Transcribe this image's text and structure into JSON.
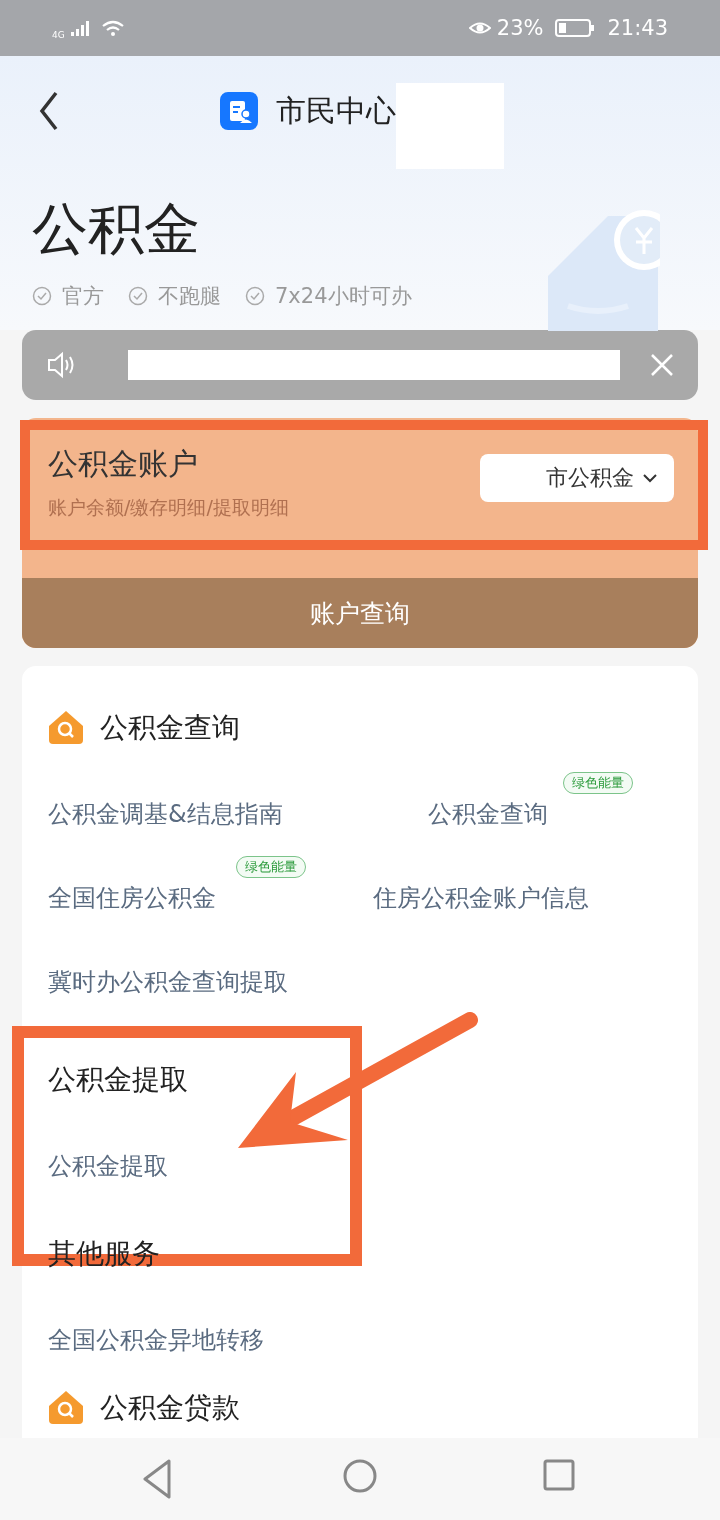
{
  "status_bar": {
    "network": "4G",
    "battery": "23%",
    "time": "21:43"
  },
  "header": {
    "title": "市民中心"
  },
  "page": {
    "title": "公积金",
    "tags": [
      "官方",
      "不跑腿",
      "7x24小时可办"
    ]
  },
  "account": {
    "title": "公积金账户",
    "subtitle": "账户余额/缴存明细/提取明细",
    "selector": "市公积金",
    "button": "账户查询",
    "highlighted": true
  },
  "sections": [
    {
      "kind": "main",
      "title": "公积金查询",
      "highlighted": false,
      "items": [
        {
          "label": "公积金调基&结息指南"
        },
        {
          "label": "公积金查询",
          "badge": "绿色能量"
        },
        {
          "label": "全国住房公积金",
          "badge": "绿色能量"
        },
        {
          "label": "住房公积金账户信息"
        },
        {
          "label": "冀时办公积金查询提取"
        }
      ]
    },
    {
      "kind": "sub",
      "title": "公积金提取",
      "highlighted": true,
      "items": [
        {
          "label": "公积金提取"
        }
      ]
    },
    {
      "kind": "sub",
      "title": "其他服务",
      "highlighted": false,
      "items": [
        {
          "label": "全国公积金异地转移"
        }
      ]
    },
    {
      "kind": "main",
      "title": "公积金贷款",
      "highlighted": false
    }
  ]
}
